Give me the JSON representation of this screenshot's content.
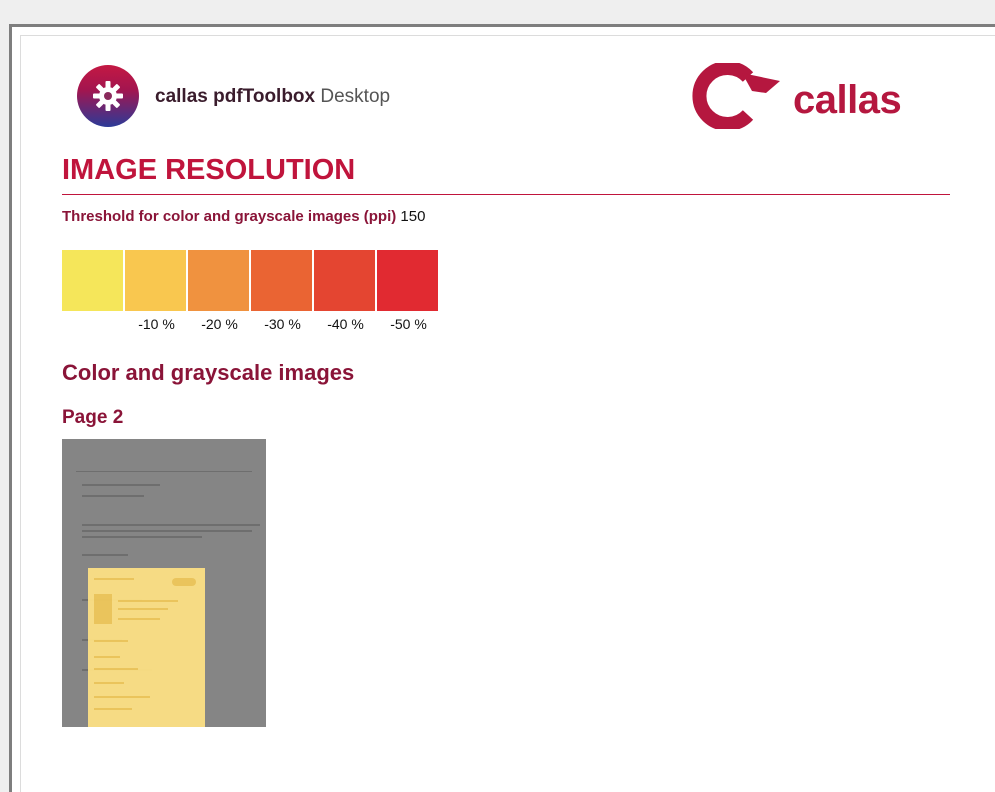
{
  "header": {
    "app_name_bold": "callas pdfToolbox",
    "app_name_rest": " Desktop",
    "brand_word": "callas",
    "brand_color": "#b5173f"
  },
  "section": {
    "title": "IMAGE RESOLUTION",
    "threshold_label": "Threshold for color and grayscale images (ppi)",
    "threshold_value": "150"
  },
  "scale": {
    "swatches": [
      {
        "color": "#f5e65a",
        "label": ""
      },
      {
        "color": "#f9c74f",
        "label": "-10 %"
      },
      {
        "color": "#f0923f",
        "label": "-20 %"
      },
      {
        "color": "#ea6433",
        "label": "-30 %"
      },
      {
        "color": "#e44531",
        "label": "-40 %"
      },
      {
        "color": "#e12a31",
        "label": "-50 %"
      }
    ]
  },
  "content": {
    "subtitle": "Color and grayscale images",
    "page_label": "Page 2",
    "thumbnail_icon": "page-thumbnail-icon"
  }
}
